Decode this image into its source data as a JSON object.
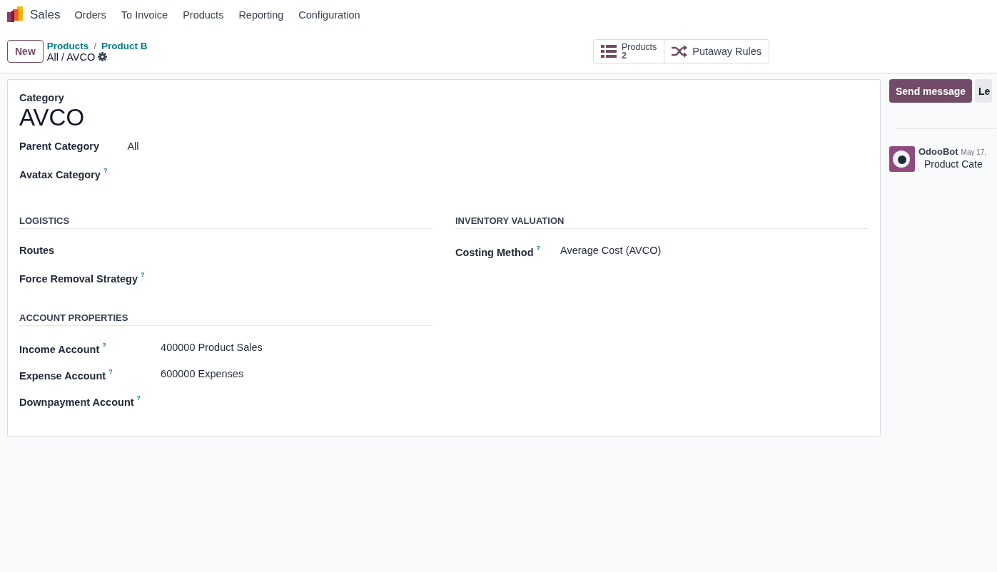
{
  "navbar": {
    "app": "Sales",
    "menu": [
      "Orders",
      "To Invoice",
      "Products",
      "Reporting",
      "Configuration"
    ]
  },
  "control_panel": {
    "new_button": "New",
    "breadcrumbs": [
      "Products",
      "Product B"
    ],
    "breadcrumb_separator": "/",
    "record_title": "All / AVCO",
    "smart_buttons": [
      {
        "kind": "stat",
        "label": "Products",
        "value": "2"
      },
      {
        "kind": "plain",
        "label": "Putaway Rules"
      }
    ]
  },
  "form": {
    "title_label": "Category",
    "title": "AVCO",
    "fields": [
      {
        "label": "Parent Category",
        "value": "All"
      },
      {
        "label": "Avatax Category",
        "help": "?"
      }
    ],
    "columns": [
      [
        {
          "title": "LOGISTICS",
          "fields": [
            {
              "label": "Routes"
            },
            {
              "label": "Force Removal Strategy",
              "help": "?"
            }
          ]
        },
        {
          "title": "ACCOUNT PROPERTIES",
          "fields": [
            {
              "label": "Income Account",
              "value": "400000 Product Sales",
              "help": "?"
            },
            {
              "label": "Expense Account",
              "value": "600000 Expenses",
              "help": "?"
            },
            {
              "label": "Downpayment Account",
              "help": "?"
            }
          ]
        }
      ],
      [
        {
          "title": "INVENTORY VALUATION",
          "fields": [
            {
              "label": "Costing Method",
              "value": "Average Cost (AVCO)",
              "help": "?"
            }
          ]
        }
      ]
    ]
  },
  "chatter": {
    "buttons": [
      {
        "label": "Send message",
        "kind": "primary"
      },
      {
        "label": "Le",
        "kind": "secondary"
      }
    ],
    "messages": [
      {
        "author": "OdooBot",
        "date": "May 17,",
        "body": "Product Cate"
      }
    ]
  }
}
